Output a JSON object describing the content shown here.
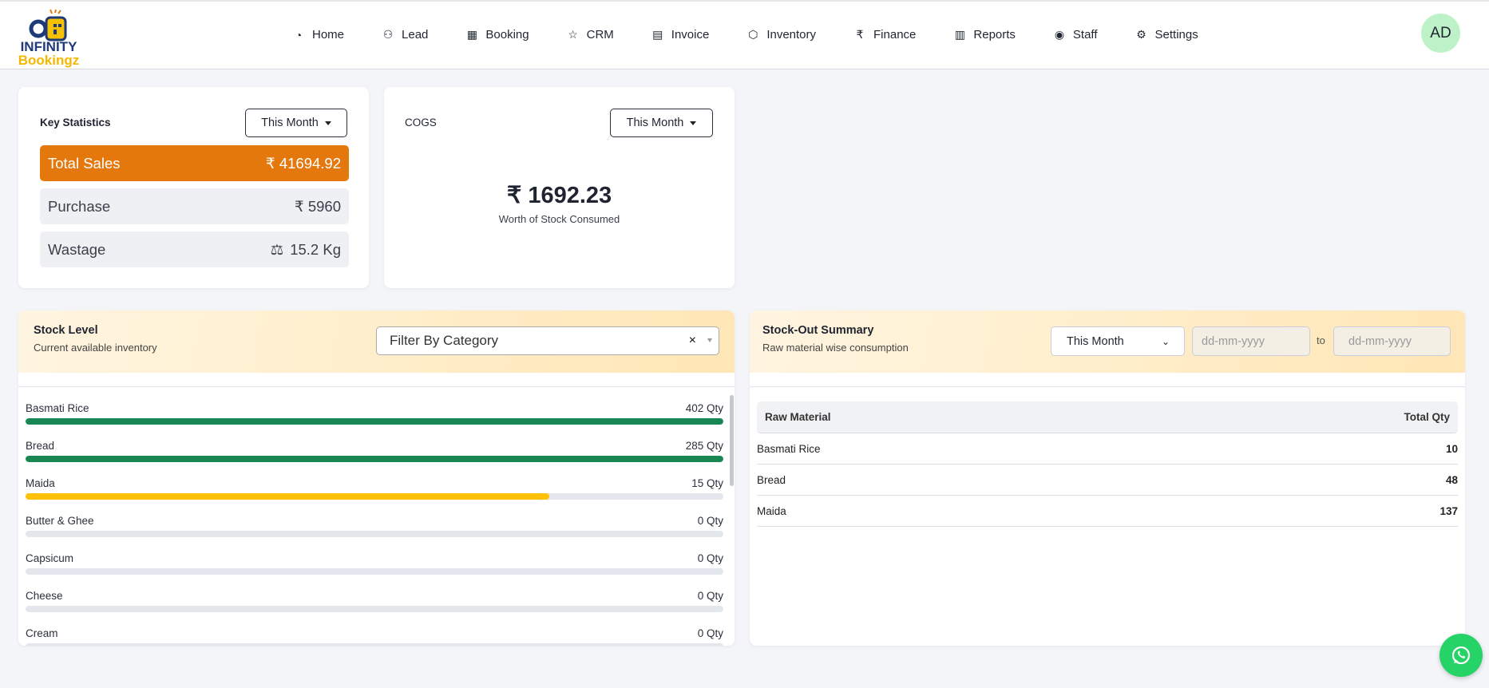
{
  "brand": {
    "line1": "INFINITY",
    "line2": "Bookingz"
  },
  "nav": [
    {
      "label": "Home",
      "icon": "pie-chart-icon"
    },
    {
      "label": "Lead",
      "icon": "users-icon"
    },
    {
      "label": "Booking",
      "icon": "calendar-icon"
    },
    {
      "label": "CRM",
      "icon": "star-icon"
    },
    {
      "label": "Invoice",
      "icon": "document-icon"
    },
    {
      "label": "Inventory",
      "icon": "box-icon"
    },
    {
      "label": "Finance",
      "icon": "rupee-icon"
    },
    {
      "label": "Reports",
      "icon": "report-icon"
    },
    {
      "label": "Staff",
      "icon": "user-circle-icon"
    },
    {
      "label": "Settings",
      "icon": "gear-icon"
    }
  ],
  "avatar": "AD",
  "key_stats": {
    "title": "Key Statistics",
    "period": "This Month",
    "total_sales_label": "Total Sales",
    "total_sales_value": "₹ 41694.92",
    "purchase_label": "Purchase",
    "purchase_value": "₹ 5960",
    "wastage_label": "Wastage",
    "wastage_value": "15.2 Kg"
  },
  "cogs": {
    "title": "COGS",
    "period": "This Month",
    "value": "₹ 1692.23",
    "caption": "Worth of Stock Consumed"
  },
  "stock_level": {
    "title": "Stock Level",
    "subtitle": "Current available inventory",
    "filter_placeholder": "Filter By Category",
    "clear": "×",
    "items": [
      {
        "name": "Basmati Rice",
        "qty": "402 Qty",
        "fill_pct": 100,
        "color": "#198754"
      },
      {
        "name": "Bread",
        "qty": "285 Qty",
        "fill_pct": 100,
        "color": "#198754"
      },
      {
        "name": "Maida",
        "qty": "15 Qty",
        "fill_pct": 75,
        "color": "#ffc107"
      },
      {
        "name": "Butter & Ghee",
        "qty": "0 Qty",
        "fill_pct": 0,
        "color": "#dc3545"
      },
      {
        "name": "Capsicum",
        "qty": "0 Qty",
        "fill_pct": 0,
        "color": "#dc3545"
      },
      {
        "name": "Cheese",
        "qty": "0 Qty",
        "fill_pct": 0,
        "color": "#dc3545"
      },
      {
        "name": "Cream",
        "qty": "0 Qty",
        "fill_pct": 0,
        "color": "#dc3545"
      }
    ]
  },
  "stock_out": {
    "title": "Stock-Out Summary",
    "subtitle": "Raw material wise consumption",
    "period": "This Month",
    "from_placeholder": "dd-mm-yyyy",
    "to_label": "to",
    "to_placeholder": "dd-mm-yyyy",
    "columns": [
      "Raw Material",
      "Total Qty"
    ],
    "rows": [
      {
        "name": "Basmati Rice",
        "qty": "10"
      },
      {
        "name": "Bread",
        "qty": "48"
      },
      {
        "name": "Maida",
        "qty": "137"
      }
    ]
  }
}
